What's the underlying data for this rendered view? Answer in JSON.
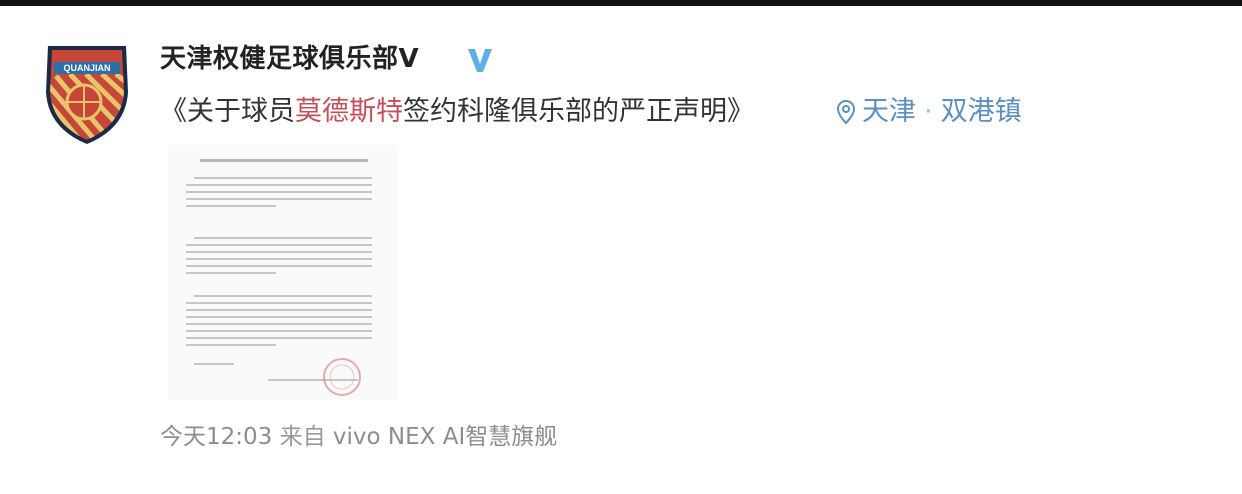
{
  "post": {
    "username": "天津权健足球俱乐部V",
    "avatar_badge_text": "QUANJIAN",
    "text_before": "《关于球员",
    "text_highlight": "莫德斯特",
    "text_after": "签约科隆俱乐部的严正声明》",
    "location_city": "天津",
    "location_sep": "·",
    "location_area": "双港镇",
    "time": "今天12:03",
    "source_prefix": "来自",
    "source_device": "vivo NEX AI智慧旗舰"
  },
  "colors": {
    "accent_highlight": "#c0505a",
    "location_blue": "#5b8fbf",
    "verified_blue": "#5fb0e8",
    "badge_red": "#b5302b"
  },
  "icons": {
    "verified": "verified-v-icon",
    "location": "location-pin-icon"
  }
}
